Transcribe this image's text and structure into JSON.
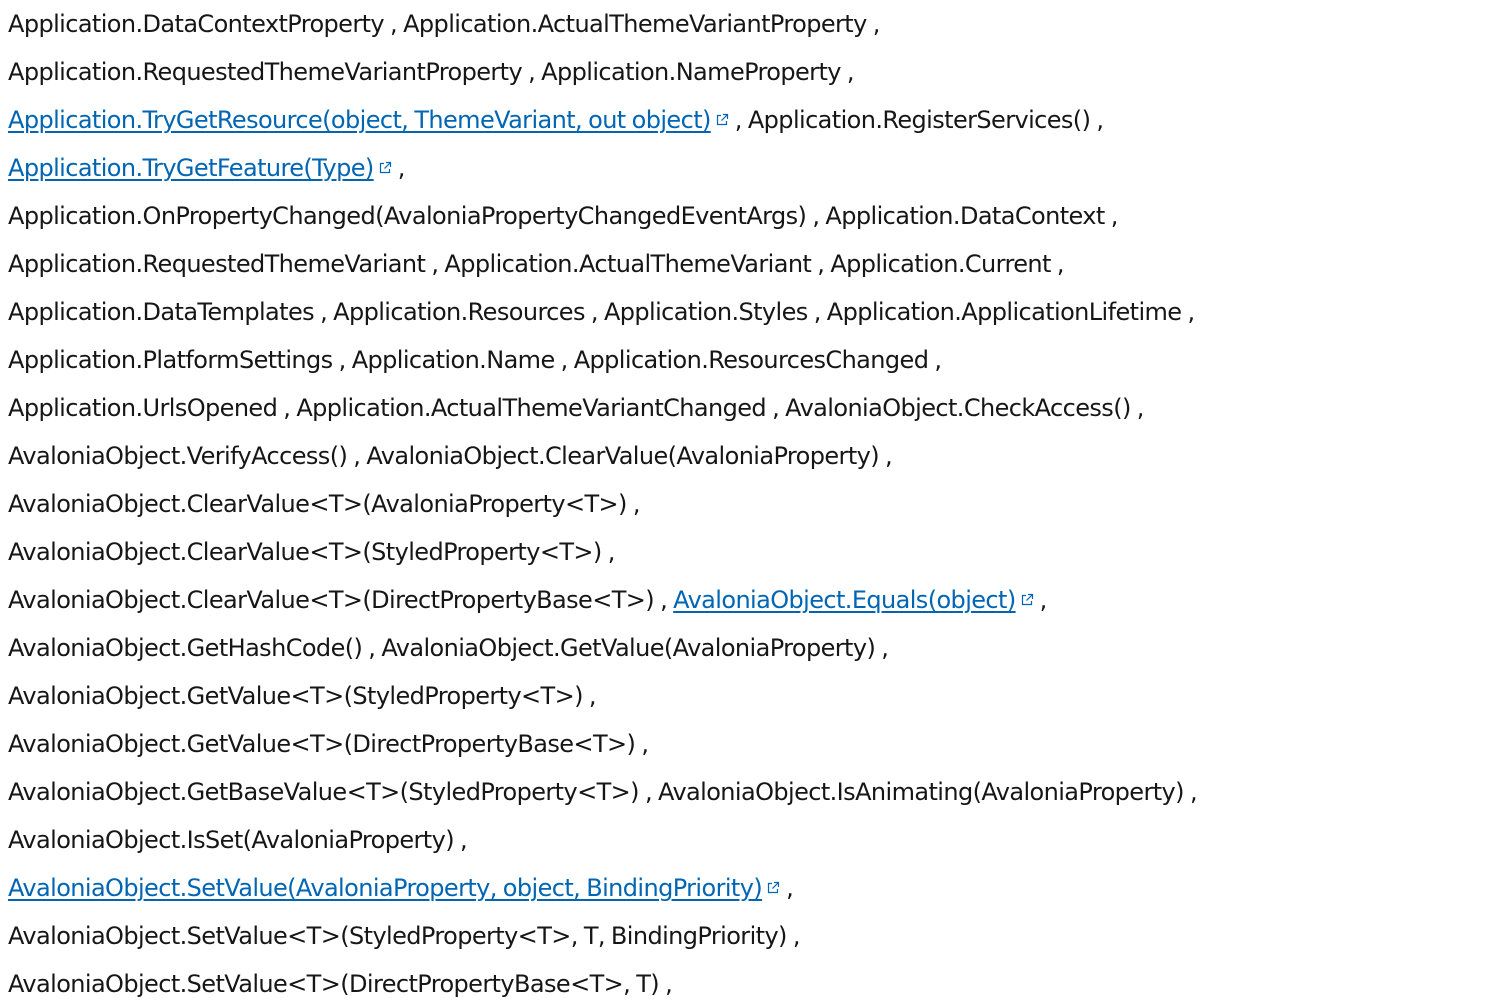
{
  "lines": [
    [
      {
        "text": "Application.DataContextProperty"
      },
      {
        "text": ", "
      },
      {
        "text": "Application.ActualThemeVariantProperty"
      },
      {
        "text": ","
      }
    ],
    [
      {
        "text": "Application.RequestedThemeVariantProperty"
      },
      {
        "text": ", "
      },
      {
        "text": "Application.NameProperty"
      },
      {
        "text": ","
      }
    ],
    [
      {
        "text": "Application.TryGetResource(object, ThemeVariant, out object)",
        "link": true
      },
      {
        "text": ", "
      },
      {
        "text": "Application.RegisterServices()"
      },
      {
        "text": ","
      }
    ],
    [
      {
        "text": "Application.TryGetFeature(Type)",
        "link": true
      },
      {
        "text": ","
      }
    ],
    [
      {
        "text": "Application.OnPropertyChanged(AvaloniaPropertyChangedEventArgs)"
      },
      {
        "text": ", "
      },
      {
        "text": "Application.DataContext"
      },
      {
        "text": ","
      }
    ],
    [
      {
        "text": "Application.RequestedThemeVariant"
      },
      {
        "text": ", "
      },
      {
        "text": "Application.ActualThemeVariant"
      },
      {
        "text": ", "
      },
      {
        "text": "Application.Current"
      },
      {
        "text": ","
      }
    ],
    [
      {
        "text": "Application.DataTemplates"
      },
      {
        "text": ", "
      },
      {
        "text": "Application.Resources"
      },
      {
        "text": ", "
      },
      {
        "text": "Application.Styles"
      },
      {
        "text": ", "
      },
      {
        "text": "Application.ApplicationLifetime"
      },
      {
        "text": ","
      }
    ],
    [
      {
        "text": "Application.PlatformSettings"
      },
      {
        "text": ", "
      },
      {
        "text": "Application.Name"
      },
      {
        "text": ", "
      },
      {
        "text": "Application.ResourcesChanged"
      },
      {
        "text": ","
      }
    ],
    [
      {
        "text": "Application.UrlsOpened"
      },
      {
        "text": ", "
      },
      {
        "text": "Application.ActualThemeVariantChanged"
      },
      {
        "text": ", "
      },
      {
        "text": "AvaloniaObject.CheckAccess()"
      },
      {
        "text": ","
      }
    ],
    [
      {
        "text": "AvaloniaObject.VerifyAccess()"
      },
      {
        "text": ", "
      },
      {
        "text": "AvaloniaObject.ClearValue(AvaloniaProperty)"
      },
      {
        "text": ","
      }
    ],
    [
      {
        "text": "AvaloniaObject.ClearValue<T>(AvaloniaProperty<T>)"
      },
      {
        "text": ","
      }
    ],
    [
      {
        "text": "AvaloniaObject.ClearValue<T>(StyledProperty<T>)"
      },
      {
        "text": ","
      }
    ],
    [
      {
        "text": "AvaloniaObject.ClearValue<T>(DirectPropertyBase<T>)"
      },
      {
        "text": ", "
      },
      {
        "text": "AvaloniaObject.Equals(object)",
        "link": true
      },
      {
        "text": ","
      }
    ],
    [
      {
        "text": "AvaloniaObject.GetHashCode()"
      },
      {
        "text": ", "
      },
      {
        "text": "AvaloniaObject.GetValue(AvaloniaProperty)"
      },
      {
        "text": ","
      }
    ],
    [
      {
        "text": "AvaloniaObject.GetValue<T>(StyledProperty<T>)"
      },
      {
        "text": ","
      }
    ],
    [
      {
        "text": "AvaloniaObject.GetValue<T>(DirectPropertyBase<T>)"
      },
      {
        "text": ","
      }
    ],
    [
      {
        "text": "AvaloniaObject.GetBaseValue<T>(StyledProperty<T>)"
      },
      {
        "text": ", "
      },
      {
        "text": "AvaloniaObject.IsAnimating(AvaloniaProperty)"
      },
      {
        "text": ","
      }
    ],
    [
      {
        "text": "AvaloniaObject.IsSet(AvaloniaProperty)"
      },
      {
        "text": ","
      }
    ],
    [
      {
        "text": "AvaloniaObject.SetValue(AvaloniaProperty, object, BindingPriority)",
        "link": true
      },
      {
        "text": ","
      }
    ],
    [
      {
        "text": "AvaloniaObject.SetValue<T>(StyledProperty<T>, T, BindingPriority)"
      },
      {
        "text": ","
      }
    ],
    [
      {
        "text": "AvaloniaObject.SetValue<T>(DirectPropertyBase<T>, T)"
      },
      {
        "text": ","
      }
    ]
  ]
}
